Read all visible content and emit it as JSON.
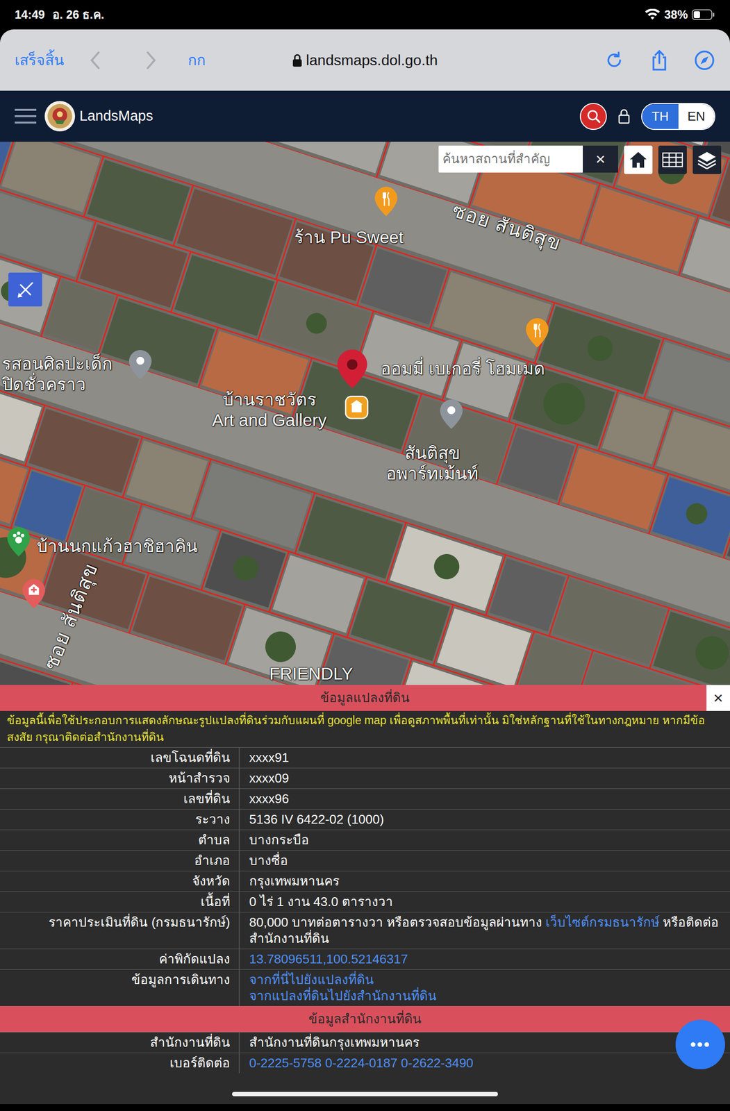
{
  "status_bar": {
    "time": "14:49",
    "date": "อ. 26 ธ.ค.",
    "battery": "38%",
    "battery_level": 0.38
  },
  "browser": {
    "done": "เสร็จสิ้น",
    "back_enabled": false,
    "forward_enabled": false,
    "text_size": "กก",
    "url": "landsmaps.dol.go.th"
  },
  "app_header": {
    "title": "LandsMaps",
    "languages": [
      {
        "label": "TH",
        "selected": true
      },
      {
        "label": "EN",
        "selected": false
      }
    ]
  },
  "map": {
    "search": {
      "placeholder": "ค้นหาสถานที่สำคัญ"
    },
    "clear": "×",
    "places": [
      {
        "lines": [
          "ซอย สันติสุข"
        ]
      },
      {
        "lines": [
          "ร้าน Pu Sweet"
        ]
      },
      {
        "lines": [
          "ออมมี่ เบเกอรี่ โฮมเมด"
        ]
      },
      {
        "lines": [
          "รสอนศิลปะเด็ก",
          "ปิดชั่วคราว"
        ]
      },
      {
        "lines": [
          "บ้านราชวัตร",
          "Art and Gallery"
        ]
      },
      {
        "lines": [
          "สันติสุข",
          "อพาร์ทเม้นท์"
        ]
      },
      {
        "lines": [
          "บ้านนกแก้วฮาชิฮาคิน"
        ]
      },
      {
        "lines": [
          "ซอย สันติสุข"
        ]
      },
      {
        "lines": [
          "FRIENDLY"
        ]
      }
    ],
    "pins": [
      {
        "kind": "food"
      },
      {
        "kind": "food"
      },
      {
        "kind": "place"
      },
      {
        "kind": "place"
      },
      {
        "kind": "park"
      },
      {
        "kind": "hospital"
      },
      {
        "kind": "parcel"
      },
      {
        "kind": "selected"
      }
    ]
  },
  "parcel_panel": {
    "title": "ข้อมูลแปลงที่ดิน",
    "close": "×",
    "disclaimer": "ข้อมูลนี้เพื่อใช้ประกอบการแสดงลักษณะรูปแปลงที่ดินร่วมกับแผนที่ google map เพื่อดูสภาพพื้นที่เท่านั้น มิใช่หลักฐานที่ใช้ในทางกฎหมาย หากมีข้อสงสัย กรุณาติดต่อสำนักงานที่ดิน",
    "rows": [
      {
        "label": "เลขโฉนดที่ดิน",
        "kind": "text",
        "parts": [
          {
            "text": "xxxx91",
            "link": false
          }
        ]
      },
      {
        "label": "หน้าสำรวจ",
        "kind": "text",
        "parts": [
          {
            "text": "xxxx09",
            "link": false
          }
        ]
      },
      {
        "label": "เลขที่ดิน",
        "kind": "text",
        "parts": [
          {
            "text": "xxxx96",
            "link": false
          }
        ]
      },
      {
        "label": "ระวาง",
        "kind": "text",
        "parts": [
          {
            "text": "5136 IV 6422-02 (1000)",
            "link": false
          }
        ]
      },
      {
        "label": "ตำบล",
        "kind": "text",
        "parts": [
          {
            "text": "บางกระบือ",
            "link": false
          }
        ]
      },
      {
        "label": "อำเภอ",
        "kind": "text",
        "parts": [
          {
            "text": "บางซื่อ",
            "link": false
          }
        ]
      },
      {
        "label": "จังหวัด",
        "kind": "text",
        "parts": [
          {
            "text": "กรุงเทพมหานคร",
            "link": false
          }
        ]
      },
      {
        "label": "เนื้อที่",
        "kind": "text",
        "parts": [
          {
            "text": "0 ไร่ 1 งาน 43.0 ตารางวา",
            "link": false
          }
        ]
      },
      {
        "label": "ราคาประเมินที่ดิน (กรมธนารักษ์)",
        "kind": "text",
        "parts": [
          {
            "text": "80,000 บาทต่อตารางวา หรือตรวจสอบข้อมูลผ่านทาง ",
            "link": false
          },
          {
            "text": "เว็บไซต์กรมธนารักษ์",
            "link": true
          },
          {
            "text": " หรือติดต่อสำนักงานที่ดิน",
            "link": false
          }
        ]
      },
      {
        "label": "ค่าพิกัดแปลง",
        "kind": "text",
        "parts": [
          {
            "text": "13.78096511,100.52146317",
            "link": true
          }
        ]
      },
      {
        "label": "ข้อมูลการเดินทาง",
        "kind": "links",
        "parts": [
          {
            "text": "จากที่นี่ไปยังแปลงที่ดิน",
            "link": true
          },
          {
            "text": "จากแปลงที่ดินไปยังสำนักงานที่ดิน",
            "link": true
          }
        ]
      }
    ]
  },
  "office_panel": {
    "title": "ข้อมูลสำนักงานที่ดิน",
    "rows": [
      {
        "label": "สำนักงานที่ดิน",
        "kind": "text",
        "parts": [
          {
            "text": "สำนักงานที่ดินกรุงเทพมหานคร",
            "link": false
          }
        ]
      },
      {
        "label": "เบอร์ติดต่อ",
        "kind": "text",
        "parts": [
          {
            "text": "0-2225-5758 0-2224-0187 0-2622-3490",
            "link": true
          }
        ]
      }
    ]
  },
  "fab": "•••"
}
